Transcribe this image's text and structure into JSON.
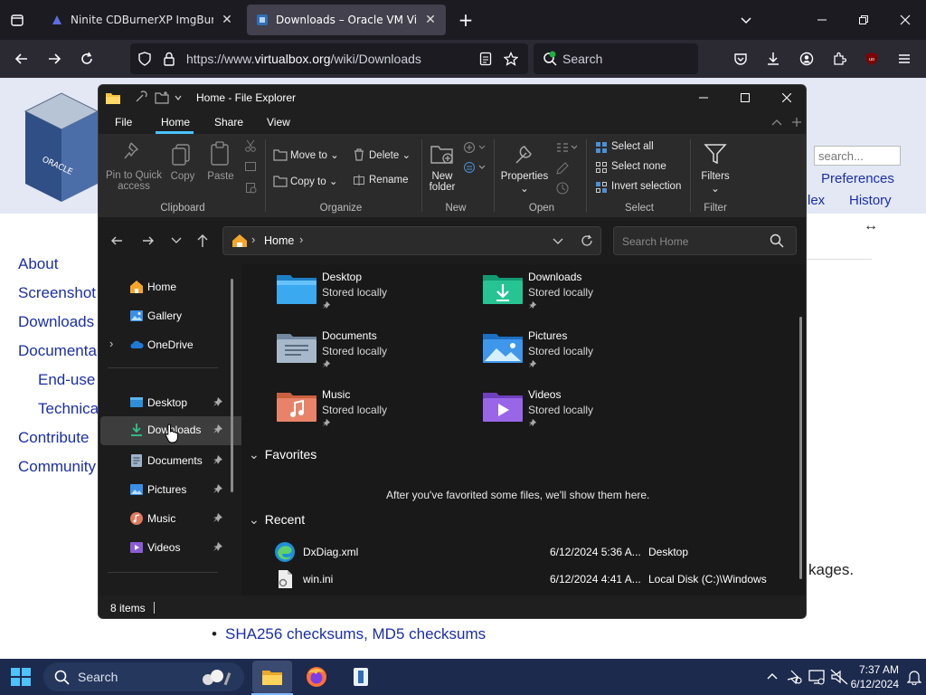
{
  "browser": {
    "tabs": [
      {
        "title": "Ninite CDBurnerXP ImgBurn Un",
        "active": false
      },
      {
        "title": "Downloads – Oracle VM Virtual",
        "active": true
      }
    ],
    "url_prefix": "https://www.",
    "url_domain": "virtualbox.org",
    "url_path": "/wiki/Downloads",
    "search_placeholder": "Search"
  },
  "webpage": {
    "nav_links": [
      "About",
      "Screenshot",
      "Downloads",
      "Documenta",
      "End-use",
      "Technica",
      "Contribute",
      "Community"
    ],
    "search_placeholder": "search...",
    "top_links": [
      "Preferences",
      "lex",
      "History"
    ],
    "partial_text": "kages.",
    "checksums_link": "SHA256 checksums, MD5 checksums"
  },
  "explorer": {
    "title": "Home - File Explorer",
    "menu_tabs": [
      "File",
      "Home",
      "Share",
      "View"
    ],
    "ribbon": {
      "pin_to_quick_access_1": "Pin to Quick",
      "pin_to_quick_access_2": "access",
      "copy": "Copy",
      "paste": "Paste",
      "move_to": "Move to",
      "copy_to": "Copy to",
      "delete": "Delete",
      "rename": "Rename",
      "new_folder_1": "New",
      "new_folder_2": "folder",
      "properties": "Properties",
      "select_all": "Select all",
      "select_none": "Select none",
      "invert_selection": "Invert selection",
      "filters": "Filters",
      "groups": [
        "Clipboard",
        "Organize",
        "New",
        "Open",
        "Select",
        "Filter"
      ]
    },
    "address": {
      "crumb": "Home"
    },
    "search_placeholder": "Search Home",
    "nav": [
      {
        "label": "Home",
        "icon": "home-icon",
        "pinned": false,
        "selected": false
      },
      {
        "label": "Gallery",
        "icon": "gallery-icon",
        "pinned": false,
        "selected": false
      },
      {
        "label": "OneDrive",
        "icon": "onedrive-icon",
        "pinned": false,
        "selected": false
      },
      {
        "label": "Desktop",
        "icon": "desktop-icon",
        "pinned": true,
        "selected": false
      },
      {
        "label": "Downloads",
        "icon": "downloads-icon",
        "pinned": true,
        "selected": true
      },
      {
        "label": "Documents",
        "icon": "documents-icon",
        "pinned": true,
        "selected": false
      },
      {
        "label": "Pictures",
        "icon": "pictures-icon",
        "pinned": true,
        "selected": false
      },
      {
        "label": "Music",
        "icon": "music-icon",
        "pinned": true,
        "selected": false
      },
      {
        "label": "Videos",
        "icon": "videos-icon",
        "pinned": true,
        "selected": false
      }
    ],
    "quick_access": [
      {
        "name": "Desktop",
        "status": "Stored locally"
      },
      {
        "name": "Downloads",
        "status": "Stored locally"
      },
      {
        "name": "Documents",
        "status": "Stored locally"
      },
      {
        "name": "Pictures",
        "status": "Stored locally"
      },
      {
        "name": "Music",
        "status": "Stored locally"
      },
      {
        "name": "Videos",
        "status": "Stored locally"
      }
    ],
    "favorites_header": "Favorites",
    "favorites_empty": "After you've favorited some files, we'll show them here.",
    "recent_header": "Recent",
    "recent": [
      {
        "name": "DxDiag.xml",
        "date": "6/12/2024 5:36 A...",
        "location": "Desktop"
      },
      {
        "name": "win.ini",
        "date": "6/12/2024 4:41 A...",
        "location": "Local Disk (C:)\\Windows"
      }
    ],
    "status": "8 items"
  },
  "taskbar": {
    "search_label": "Search",
    "time": "7:37 AM",
    "date": "6/12/2024"
  },
  "colors": {
    "explorer_bg": "#202020",
    "ribbon_bg": "#2b2b2b",
    "link_blue": "#1a2fa8",
    "taskbar_bg": "#1c2a4d",
    "folder_yellow": "#f4c342",
    "accent_blue": "#0a84ff"
  }
}
